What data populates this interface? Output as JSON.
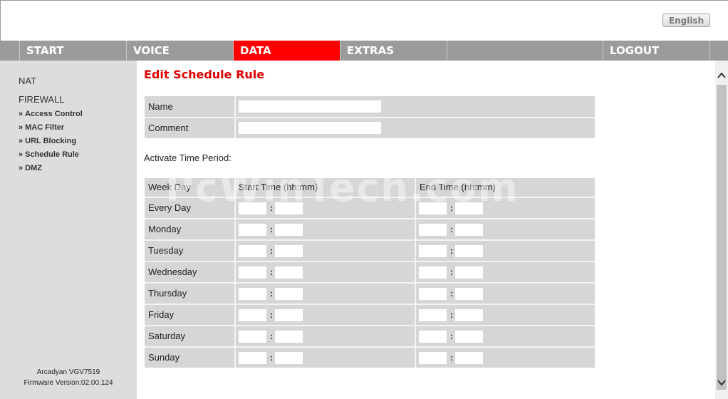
{
  "header": {
    "language_label": "English"
  },
  "nav": {
    "items": [
      {
        "label": "START"
      },
      {
        "label": "VOICE"
      },
      {
        "label": "DATA"
      },
      {
        "label": "EXTRAS"
      },
      {
        "label": ""
      },
      {
        "label": "LOGOUT"
      }
    ],
    "active_color": "#ff0000"
  },
  "sidebar": {
    "sections": [
      {
        "label": "NAT"
      },
      {
        "label": "FIREWALL"
      }
    ],
    "links": [
      {
        "label": "Access Control"
      },
      {
        "label": "MAC Filter"
      },
      {
        "label": "URL Blocking"
      },
      {
        "label": "Schedule Rule"
      },
      {
        "label": "DMZ"
      }
    ],
    "link_prefix": "»",
    "footer": {
      "model": "Arcadyan VGV7519",
      "firmware": "Firmware Version:02.00.124"
    }
  },
  "main": {
    "title": "Edit Schedule Rule",
    "name_label": "Name",
    "name_value": "",
    "comment_label": "Comment",
    "comment_value": "",
    "activate_label": "Activate Time Period:",
    "table": {
      "headers": [
        "Week Day",
        "Start Time (hh:mm)",
        "End Time (hh:mm)"
      ],
      "days": [
        "Every Day",
        "Monday",
        "Tuesday",
        "Wednesday",
        "Thursday",
        "Friday",
        "Saturday",
        "Sunday"
      ],
      "separator": ":"
    },
    "watermark": "PcWinTech.com"
  }
}
